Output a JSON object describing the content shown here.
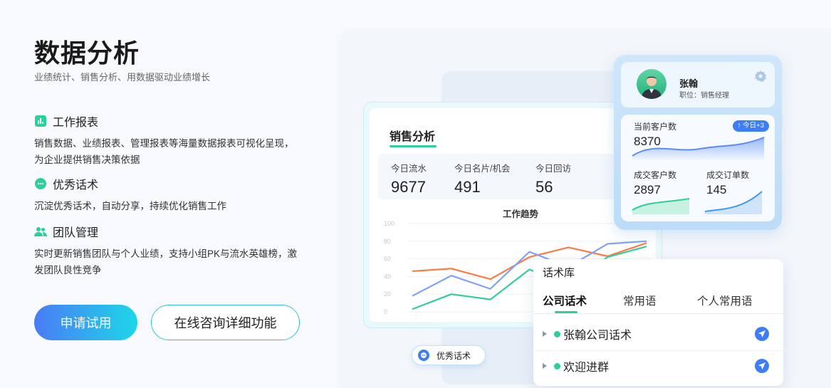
{
  "hero": {
    "title": "数据分析",
    "subtitle": "业绩统计、销售分析、用数据驱动业绩增长"
  },
  "features": [
    {
      "icon": "bar-chart-icon",
      "title": "工作报表",
      "desc": "销售数据、业绩报表、管理报表等海量数据报表可视化呈现，为企业提供销售决策依据"
    },
    {
      "icon": "chat-bubble-icon",
      "title": "优秀话术",
      "desc": "沉淀优秀话术，自动分享，持续优化销售工作"
    },
    {
      "icon": "team-icon",
      "title": "团队管理",
      "desc": "实时更新销售团队与个人业绩，支持小组PK与流水英雄榜，激发团队良性竞争"
    }
  ],
  "buttons": {
    "trial": "申请试用",
    "consult": "在线咨询详细功能"
  },
  "colors": {
    "accent_green": "#2ccf97",
    "accent_blue": "#3d7ef6",
    "line_orange": "#ff7a45",
    "line_blue": "#7ea3f5",
    "line_green": "#34cf94"
  },
  "sales_card": {
    "title": "销售分析",
    "stats": [
      {
        "label": "今日流水",
        "value": "9677"
      },
      {
        "label": "今日名片/机会",
        "value": "491"
      },
      {
        "label": "今日回访",
        "value": "56"
      }
    ]
  },
  "chart_data": {
    "type": "line",
    "title": "工作趋势",
    "y_ticks": [
      "100",
      "80",
      "60",
      "40",
      "20",
      "0"
    ],
    "ylim": [
      0,
      100
    ],
    "grid": true,
    "legend": "none",
    "series": [
      {
        "color": "#ff7a45",
        "values": [
          46,
          49,
          37,
          62,
          73,
          63,
          78
        ]
      },
      {
        "color": "#7ea3f5",
        "values": [
          18,
          41,
          26,
          68,
          51,
          77,
          80
        ]
      },
      {
        "color": "#34cf94",
        "values": [
          3,
          20,
          14,
          48,
          30,
          62,
          74
        ]
      }
    ]
  },
  "profile": {
    "name": "张翰",
    "role": "职位：销售经理",
    "current_customers_label": "当前客户数",
    "current_customers": "8370",
    "today_badge": "今日+3",
    "deal_customers_label": "成交客户数",
    "deal_customers": "2897",
    "deal_orders_label": "成交订单数",
    "deal_orders": "145"
  },
  "speech_lib": {
    "title": "话术库",
    "tabs": [
      "公司话术",
      "常用语",
      "个人常用语"
    ],
    "items": [
      "张翰公司话术",
      "欢迎进群"
    ]
  },
  "chip": {
    "label": "优秀话术"
  }
}
